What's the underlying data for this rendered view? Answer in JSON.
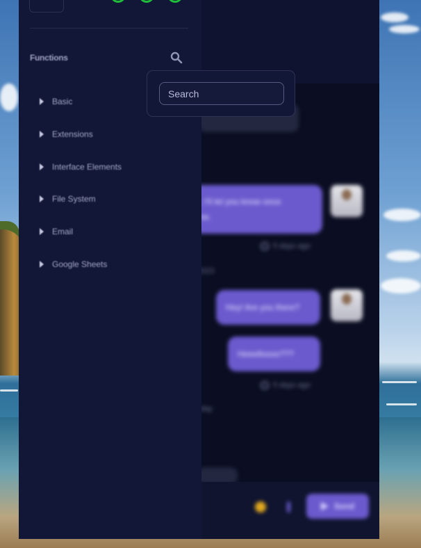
{
  "sidebar": {
    "section_title": "Functions",
    "search_icon": "search-icon",
    "chevron_icon": "chevron-right-icon",
    "status_color": "#1fbf3a",
    "items": [
      {
        "label": "Basic"
      },
      {
        "label": "Extensions"
      },
      {
        "label": "Interface Elements"
      },
      {
        "label": "File System"
      },
      {
        "label": "Email"
      },
      {
        "label": "Google Sheets"
      }
    ]
  },
  "search": {
    "placeholder": "Search",
    "value": ""
  },
  "chat": {
    "messages": [
      {
        "text": "ne. I'll let you know once done.",
        "line1": "ne. I'll let you know once",
        "line2": "done."
      },
      {
        "text": "Hey! Are you there?"
      },
      {
        "text": "Heeelloooo???"
      }
    ],
    "timestamps": [
      "5 days ago",
      "5 days ago"
    ],
    "date_separators": [
      "2023",
      "day"
    ],
    "composer": {
      "emoji_icon": "emoji-icon",
      "attach_icon": "attach-icon",
      "send_label": "Send",
      "send_icon": "send-icon"
    }
  },
  "colors": {
    "accent": "#6a5acd",
    "sidebar_bg": "#131737",
    "app_bg": "#0b0e22"
  }
}
